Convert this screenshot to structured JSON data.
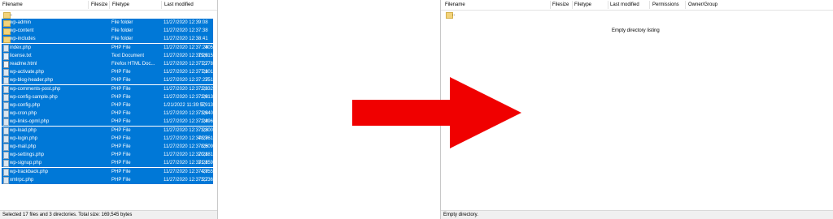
{
  "local": {
    "columns": [
      "Filename",
      "Filesize",
      "Filetype",
      "Last modified"
    ],
    "parent": "..",
    "files": [
      {
        "name": "wp-admin",
        "size": "",
        "type": "File folder",
        "modified": "11/27/2020 12:39:08",
        "icon": "folder-icon"
      },
      {
        "name": "wp-content",
        "size": "",
        "type": "File folder",
        "modified": "11/27/2020 12:37:38",
        "icon": "folder-icon"
      },
      {
        "name": "wp-includes",
        "size": "",
        "type": "File folder",
        "modified": "11/27/2020 12:38:41",
        "icon": "folder-icon"
      },
      {
        "name": "index.php",
        "size": "405",
        "type": "PHP File",
        "modified": "11/27/2020 12:37:28",
        "icon": "php-file-icon"
      },
      {
        "name": "license.txt",
        "size": "19,915",
        "type": "Text Document",
        "modified": "11/27/2020 12:37:28",
        "icon": "text-file-icon"
      },
      {
        "name": "readme.html",
        "size": "7,278",
        "type": "Firefox HTML Doc...",
        "modified": "11/27/2020 12:37:27",
        "icon": "html-file-icon"
      },
      {
        "name": "wp-activate.php",
        "size": "7,101",
        "type": "PHP File",
        "modified": "11/27/2020 12:37:28",
        "icon": "php-file-icon"
      },
      {
        "name": "wp-blog-header.php",
        "size": "351",
        "type": "PHP File",
        "modified": "11/27/2020 12:37:27",
        "icon": "php-file-icon"
      },
      {
        "name": "wp-comments-post.php",
        "size": "2,332",
        "type": "PHP File",
        "modified": "11/27/2020 12:37:28",
        "icon": "php-file-icon"
      },
      {
        "name": "wp-config-sample.php",
        "size": "2,913",
        "type": "PHP File",
        "modified": "11/27/2020 12:37:28",
        "icon": "php-file-icon"
      },
      {
        "name": "wp-config.php",
        "size": "2,913",
        "type": "PHP File",
        "modified": "1/21/2022 11:39:57",
        "icon": "php-file-icon"
      },
      {
        "name": "wp-cron.php",
        "size": "3,940",
        "type": "PHP File",
        "modified": "11/27/2020 12:37:28",
        "icon": "php-file-icon"
      },
      {
        "name": "wp-links-opml.php",
        "size": "2,496",
        "type": "PHP File",
        "modified": "11/27/2020 12:37:28",
        "icon": "php-file-icon"
      },
      {
        "name": "wp-load.php",
        "size": "3,300",
        "type": "PHP File",
        "modified": "11/27/2020 12:37:28",
        "icon": "php-file-icon"
      },
      {
        "name": "wp-login.php",
        "size": "48,761",
        "type": "PHP File",
        "modified": "11/27/2020 12:37:28",
        "icon": "php-file-icon"
      },
      {
        "name": "wp-mail.php",
        "size": "8,509",
        "type": "PHP File",
        "modified": "11/27/2020 12:37:28",
        "icon": "php-file-icon"
      },
      {
        "name": "wp-settings.php",
        "size": "20,181",
        "type": "PHP File",
        "modified": "11/27/2020 12:37:28",
        "icon": "php-file-icon"
      },
      {
        "name": "wp-signup.php",
        "size": "31,159",
        "type": "PHP File",
        "modified": "11/27/2020 12:37:28",
        "icon": "php-file-icon"
      },
      {
        "name": "wp-trackback.php",
        "size": "4,755",
        "type": "PHP File",
        "modified": "11/27/2020 12:37:28",
        "icon": "php-file-icon"
      },
      {
        "name": "xmlrpc.php",
        "size": "3,236",
        "type": "PHP File",
        "modified": "11/27/2020 12:37:27",
        "icon": "php-file-icon"
      }
    ],
    "status": "Selected 17 files and 3 directories. Total size: 169,545 bytes"
  },
  "remote": {
    "columns": [
      "Filename",
      "Filesize",
      "Filetype",
      "Last modified",
      "Permissions",
      "Owner/Group"
    ],
    "parent": "..",
    "empty_message": "Empty directory listing",
    "status": "Empty directory."
  },
  "colors": {
    "selection": "#0078d7",
    "arrow": "#f00000"
  }
}
